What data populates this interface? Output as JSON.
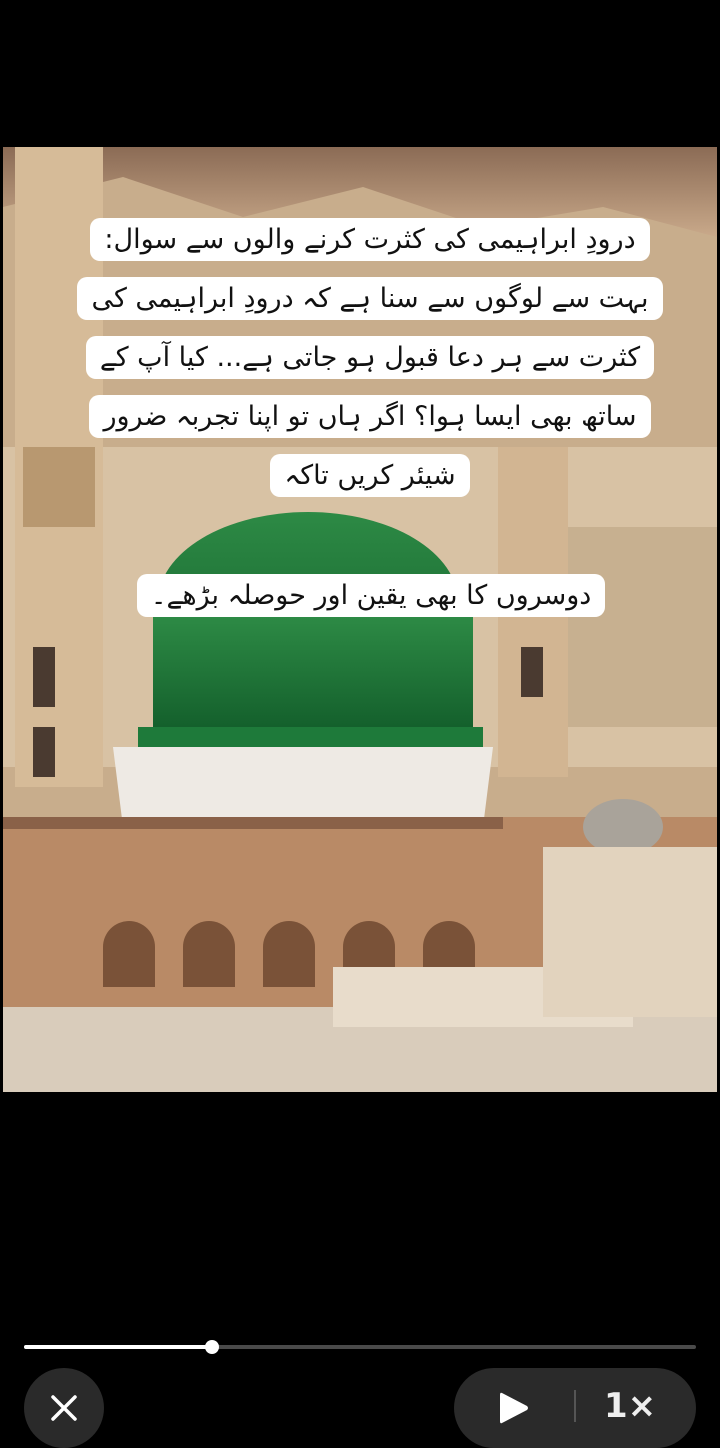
{
  "caption": {
    "lines": [
      "درودِ ابراہیمی کی کثرت کرنے والوں سے سوال:",
      "بہت سے لوگوں سے سنا ہے کہ درودِ ابراہیمی کی",
      "کثرت سے ہر دعا قبول ہو جاتی ہے... کیا آپ کے",
      "ساتھ بھی ایسا ہوا؟ اگر ہاں تو اپنا تجربہ ضرور",
      "شیئر کریں تاکہ"
    ],
    "second_box": "دوسروں کا بھی یقین اور حوصلہ بڑھے۔"
  },
  "player": {
    "progress": 0.28,
    "speed_label": "1×",
    "close_icon": "close-icon",
    "play_icon": "play-icon"
  }
}
